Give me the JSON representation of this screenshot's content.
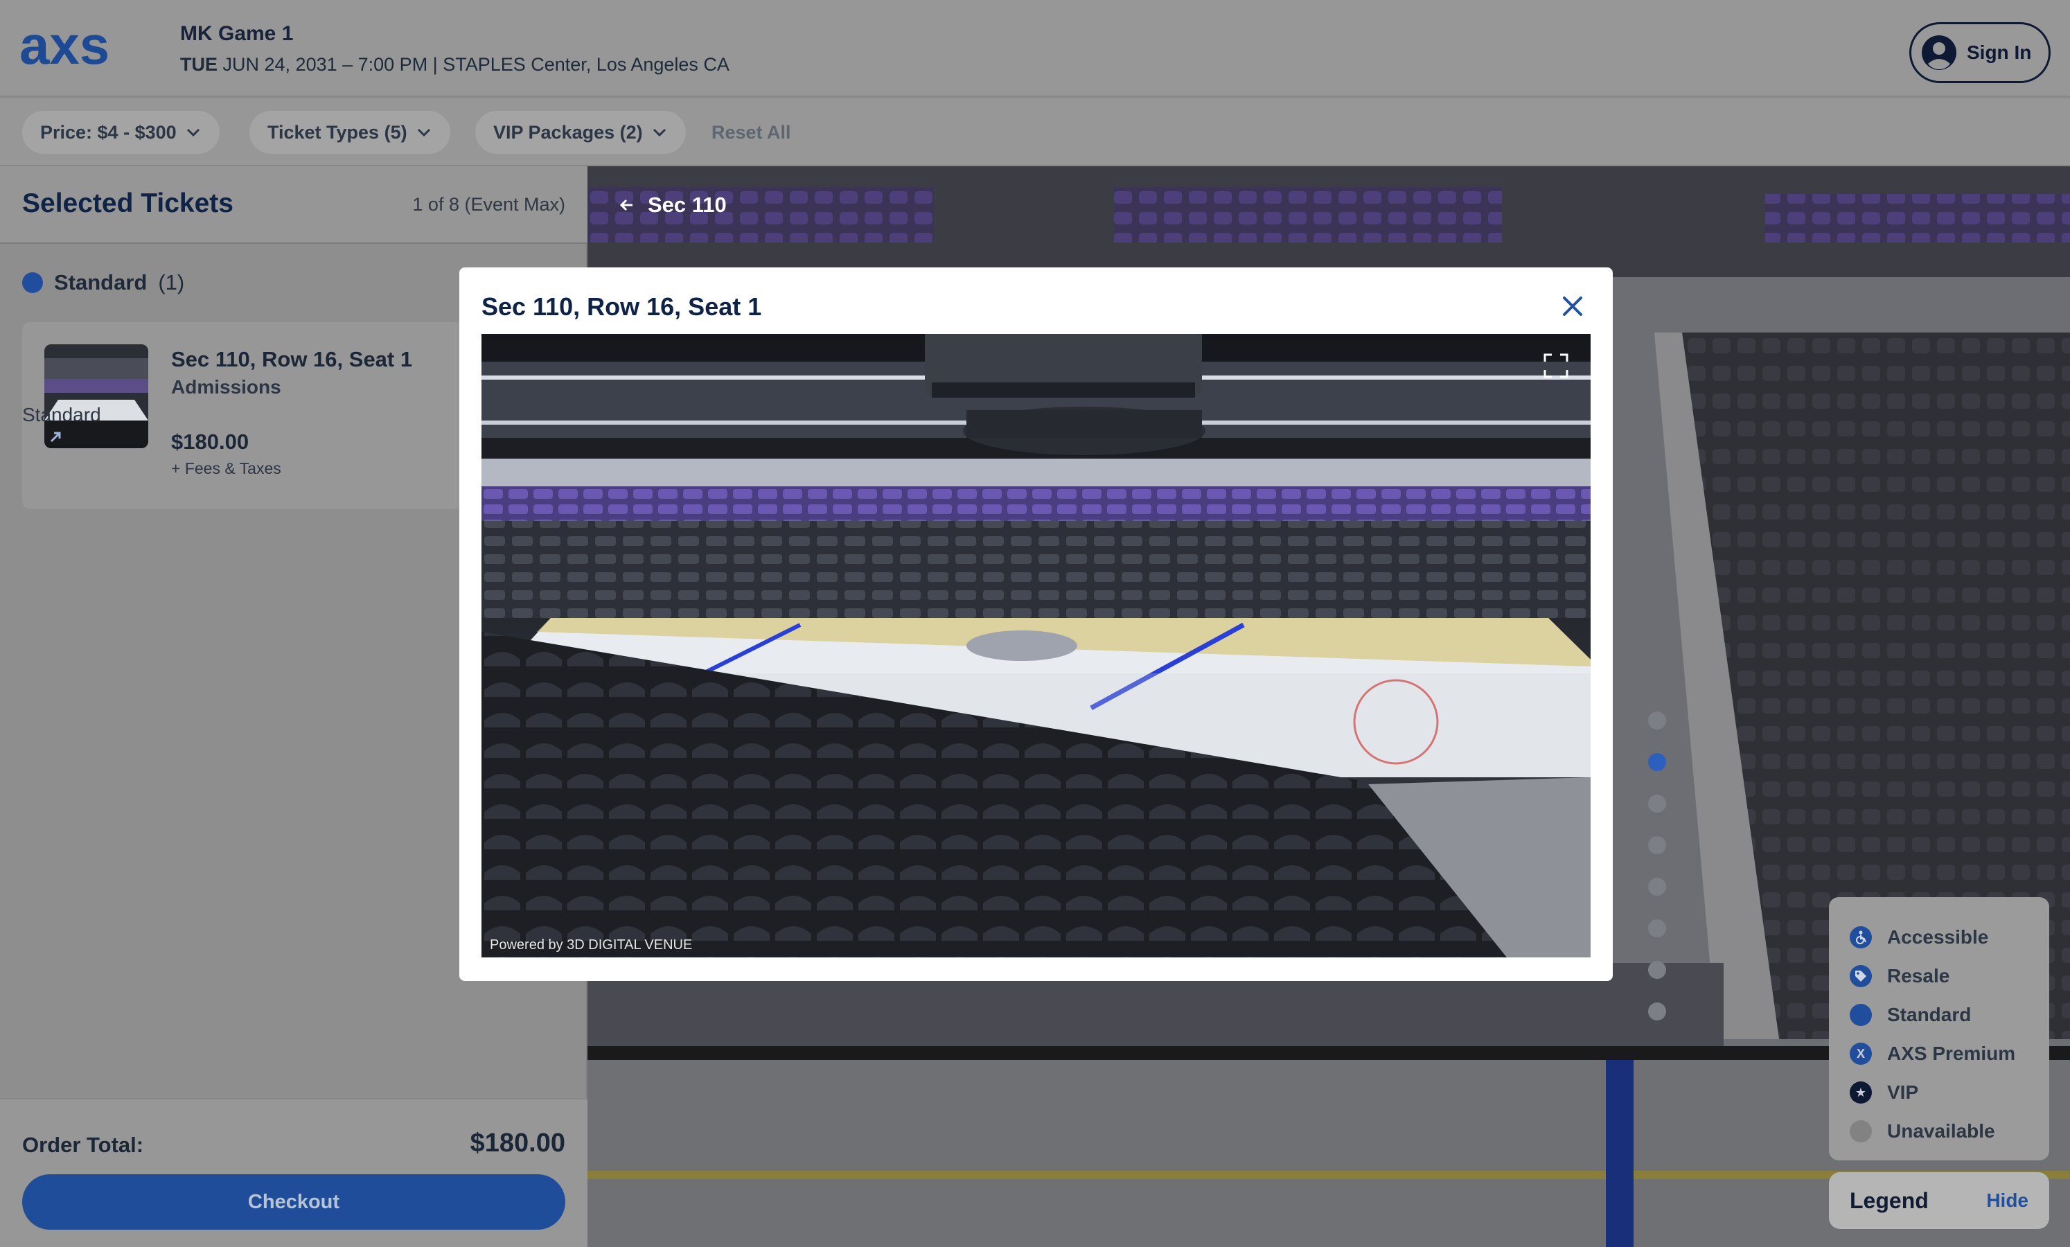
{
  "header": {
    "logo_text": "axs",
    "event_title": "MK Game 1",
    "event_day": "TUE",
    "event_details": "JUN 24, 2031 – 7:00 PM | STAPLES Center, Los Angeles CA",
    "signin_label": "Sign In"
  },
  "filters": {
    "price": "Price: $4 - $300",
    "ticket_types": "Ticket Types (5)",
    "vip_packages": "VIP Packages (2)",
    "reset": "Reset All"
  },
  "selected": {
    "title": "Selected Tickets",
    "max": "1 of 8 (Event Max)",
    "group_label": "Standard",
    "group_count": "(1)",
    "ticket": {
      "title": "Sec 110, Row 16, Seat 1",
      "admission": "Admissions",
      "type": "Standard",
      "price": "$180.00",
      "fees": "+ Fees & Taxes"
    }
  },
  "order": {
    "label": "Order Total:",
    "total": "$180.00",
    "checkout": "Checkout"
  },
  "map": {
    "section_label": "Sec 110"
  },
  "modal": {
    "title": "Sec 110, Row 16, Seat 1",
    "powered": "Powered by 3D DIGITAL VENUE"
  },
  "legend": {
    "items": [
      "Accessible",
      "Resale",
      "Standard",
      "AXS Premium",
      "VIP",
      "Unavailable"
    ],
    "title": "Legend",
    "hide": "Hide"
  },
  "colors": {
    "brand": "#1f4d99",
    "navy": "#0f2346",
    "seat_standard": "#214e9c"
  }
}
